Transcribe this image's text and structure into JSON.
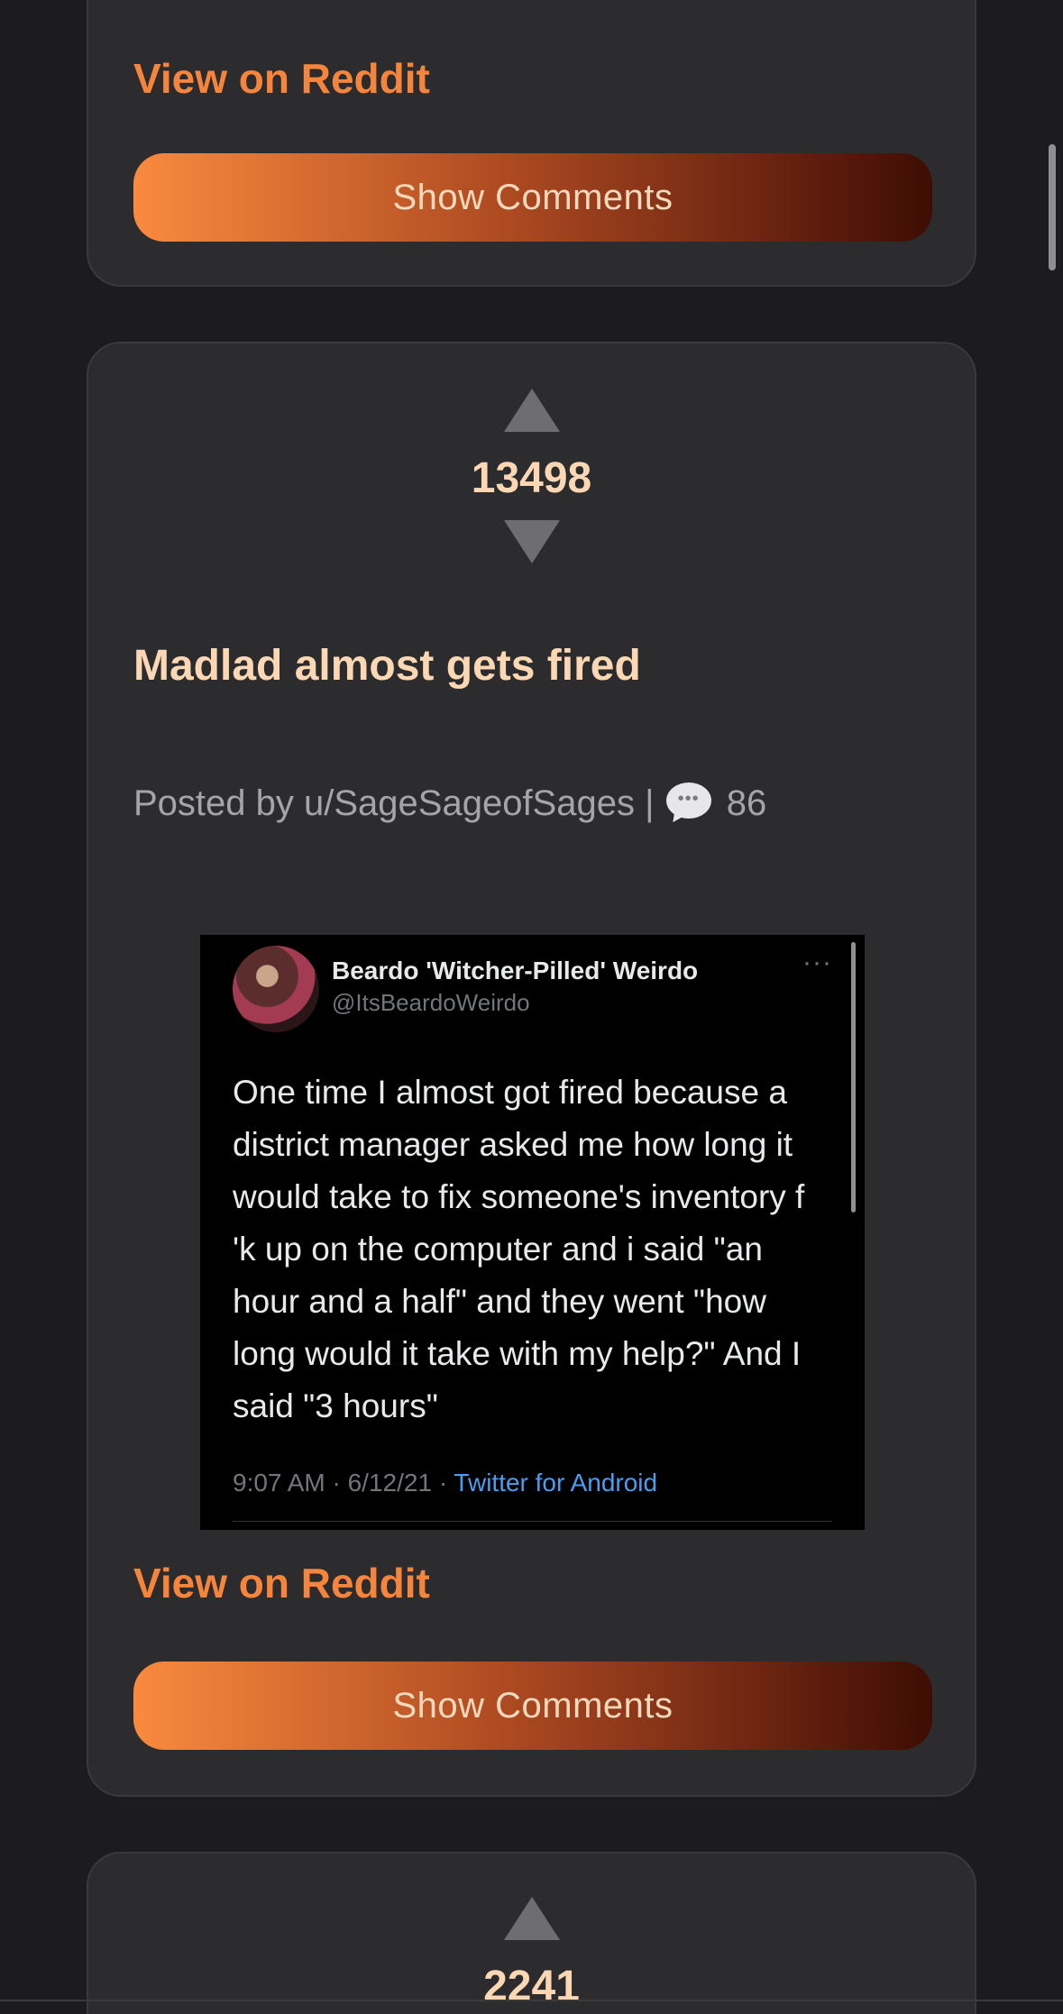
{
  "previous_post": {
    "view_link": "View on Reddit",
    "show_comments": "Show Comments"
  },
  "post": {
    "score": "13498",
    "title": "Madlad almost gets fired",
    "meta_prefix": "Posted by u/SageSageofSages |",
    "comment_count": "86",
    "view_link": "View on Reddit",
    "show_comments": "Show Comments",
    "embedded_tweet": {
      "author_name": "Beardo 'Witcher-Pilled' Weirdo",
      "author_handle": "@ItsBeardoWeirdo",
      "more": "···",
      "text": "One time I almost got fired because a district manager asked me how long it would take to fix someone's inventory f    'k up on the computer and i said \"an hour and a half\" and they went \"how long would it take with my help?\" And I said \"3 hours\"",
      "timestamp": "9:07 AM · 6/12/21 ·",
      "source": "Twitter for Android"
    }
  },
  "next_post": {
    "score": "2241"
  },
  "theme": {
    "accent": "#f5843c",
    "title_color": "#fbd7b3",
    "card_bg": "#2c2c2e",
    "page_bg": "#1c1c1e"
  },
  "icons": {
    "upvote": "triangle-up",
    "downvote": "triangle-down",
    "comments": "speech-bubble"
  }
}
